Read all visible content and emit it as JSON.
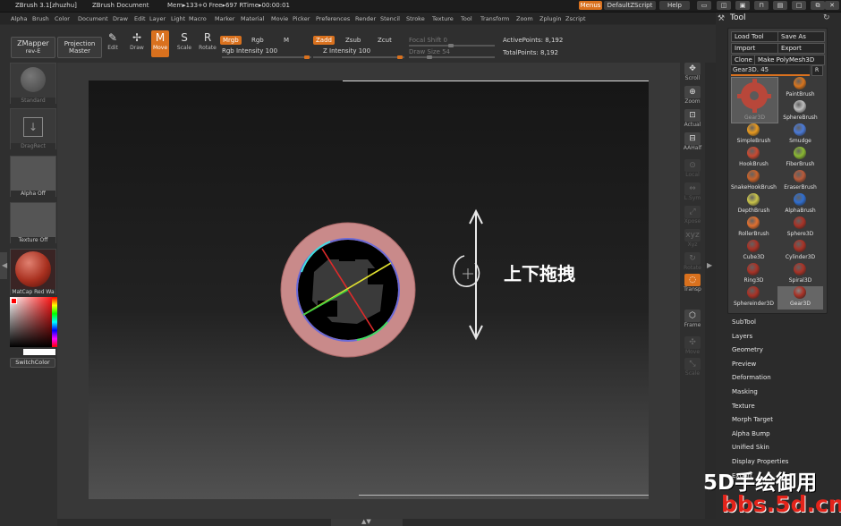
{
  "titlebar": {
    "app": "ZBrush 3.1[zhuzhu]",
    "document": "ZBrush Document",
    "stats": "Mem▸133+0 Free▸697 RTime▸00:00:01",
    "menus_button": "Menus",
    "script_button": "DefaultZScript",
    "help_button": "Help"
  },
  "menubar": [
    "Alpha",
    "Brush",
    "Color",
    "Document",
    "Draw",
    "Edit",
    "Layer",
    "Light",
    "Macro",
    "Marker",
    "Material",
    "Movie",
    "Picker",
    "Preferences",
    "Render",
    "Stencil",
    "Stroke",
    "Texture",
    "Tool",
    "Transform",
    "Zoom",
    "Zplugin",
    "Zscript"
  ],
  "toolbar": {
    "zmapper_title": "ZMapper",
    "zmapper_sub": "rev-E",
    "projection_title": "Projection",
    "projection_sub": "Master",
    "modes": [
      {
        "label": "Edit",
        "glyph": "✎"
      },
      {
        "label": "Draw",
        "glyph": "✢"
      },
      {
        "label": "Move",
        "glyph": "M"
      },
      {
        "label": "Scale",
        "glyph": "S"
      },
      {
        "label": "Rotate",
        "glyph": "R"
      }
    ],
    "mrgb": "Mrgb",
    "rgb": "Rgb",
    "m": "M",
    "rgb_intensity": "Rgb Intensity 100",
    "zadd": "Zadd",
    "zsub": "Zsub",
    "zcut": "Zcut",
    "z_intensity": "Z Intensity 100",
    "focal_shift": "Focal Shift 0",
    "draw_size": "Draw Size 54",
    "active_points": "ActivePoints: 8,192",
    "total_points": "TotalPoints: 8,192"
  },
  "leftshelf": {
    "standard": "Standard",
    "dragrect": "DragRect",
    "alpha": "Alpha  Off",
    "texture": "Texture  Off",
    "matcap": "MatCap  Red  Wa",
    "switch_color": "SwitchColor"
  },
  "rightshelf": [
    "Scroll",
    "Zoom",
    "Actual",
    "AAHalf",
    "Local",
    "L.Sym",
    "Xpose",
    "Xyz",
    "Rotate",
    "Transp",
    "Frame",
    "Move",
    "Scale"
  ],
  "tray": {
    "title": "Tool",
    "load_tool": "Load Tool",
    "save_as": "Save As",
    "import": "Import",
    "export": "Export",
    "clone": "Clone",
    "make_polymesh": "Make PolyMesh3D",
    "current_tool": "Gear3D. 45",
    "r_button": "R",
    "selected_tool_caption": "Gear3D",
    "tools": [
      {
        "name": "PaintBrush",
        "color": "#d8751e"
      },
      {
        "name": "SphereBrush",
        "color": "#bdbdbd"
      },
      {
        "name": "SimpleBrush",
        "color": "#e89a1f"
      },
      {
        "name": "Smudge",
        "color": "#4a7ad8"
      },
      {
        "name": "HookBrush",
        "color": "#c84a32"
      },
      {
        "name": "FiberBrush",
        "color": "#8ab832"
      },
      {
        "name": "SnakeHookBrush",
        "color": "#c8622a"
      },
      {
        "name": "EraserBrush",
        "color": "#b85a3a"
      },
      {
        "name": "DepthBrush",
        "color": "#c9c44a"
      },
      {
        "name": "AlphaBrush",
        "color": "#2f6ed0"
      },
      {
        "name": "RollerBrush",
        "color": "#e07030"
      },
      {
        "name": "Sphere3D",
        "color": "#a83226"
      },
      {
        "name": "Cube3D",
        "color": "#a83226"
      },
      {
        "name": "Cylinder3D",
        "color": "#a83226"
      },
      {
        "name": "Ring3D",
        "color": "#a83226"
      },
      {
        "name": "Spiral3D",
        "color": "#a83226"
      },
      {
        "name": "Sphereinder3D",
        "color": "#a83226"
      },
      {
        "name": "Gear3D",
        "color": "#a83226"
      }
    ],
    "sections": [
      "SubTool",
      "Layers",
      "Geometry",
      "Preview",
      "Deformation",
      "Masking",
      "Texture",
      "Morph Target",
      "Alpha Bump",
      "Unified Skin",
      "Display Properties",
      "Export"
    ]
  },
  "annotation": "上下拖拽",
  "watermark_line1": "5D手绘御用",
  "watermark_line2": "bbs.5d.cn"
}
